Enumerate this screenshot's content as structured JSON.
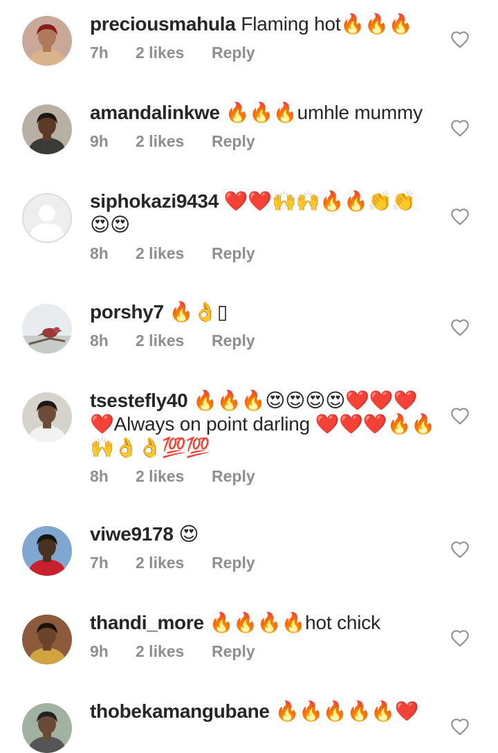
{
  "comments": [
    {
      "username": "preciousmahula",
      "text": "Flaming hot🔥🔥🔥",
      "time": "7h",
      "likes": "2 likes",
      "reply": "Reply",
      "avatar": "photo"
    },
    {
      "username": "amandalinkwe",
      "text": "🔥🔥🔥umhle mummy",
      "time": "9h",
      "likes": "2 likes",
      "reply": "Reply",
      "avatar": "photo"
    },
    {
      "username": "siphokazi9434",
      "text": "❤️❤️🙌🙌🔥🔥👏👏😍😍",
      "time": "8h",
      "likes": "2 likes",
      "reply": "Reply",
      "avatar": "default-user-icon"
    },
    {
      "username": "porshy7",
      "text": "🔥👌▯",
      "time": "8h",
      "likes": "2 likes",
      "reply": "Reply",
      "avatar": "bird-photo"
    },
    {
      "username": "tsestefly40",
      "text": "🔥🔥🔥😍😍😍😍❤️❤️❤️❤️Always on point darling ❤️❤️❤️🔥🔥🙌👌👌💯💯",
      "time": "8h",
      "likes": "2 likes",
      "reply": "Reply",
      "avatar": "photo"
    },
    {
      "username": "viwe9178",
      "text": "😍",
      "time": "7h",
      "likes": "2 likes",
      "reply": "Reply",
      "avatar": "photo"
    },
    {
      "username": "thandi_more",
      "text": "🔥🔥🔥🔥hot chick",
      "time": "9h",
      "likes": "2 likes",
      "reply": "Reply",
      "avatar": "photo"
    },
    {
      "username": "thobekamangubane",
      "text": "🔥🔥🔥🔥🔥❤️",
      "time": "",
      "likes": "",
      "reply": "",
      "avatar": "photo"
    }
  ],
  "icons": {
    "like": "heart-outline-icon",
    "default_avatar": "user-silhouette-icon"
  },
  "colors": {
    "username": "#262626",
    "text": "#262626",
    "meta": "#8e8e8e",
    "heart_outline": "#8e8e8e",
    "background": "#ffffff"
  }
}
